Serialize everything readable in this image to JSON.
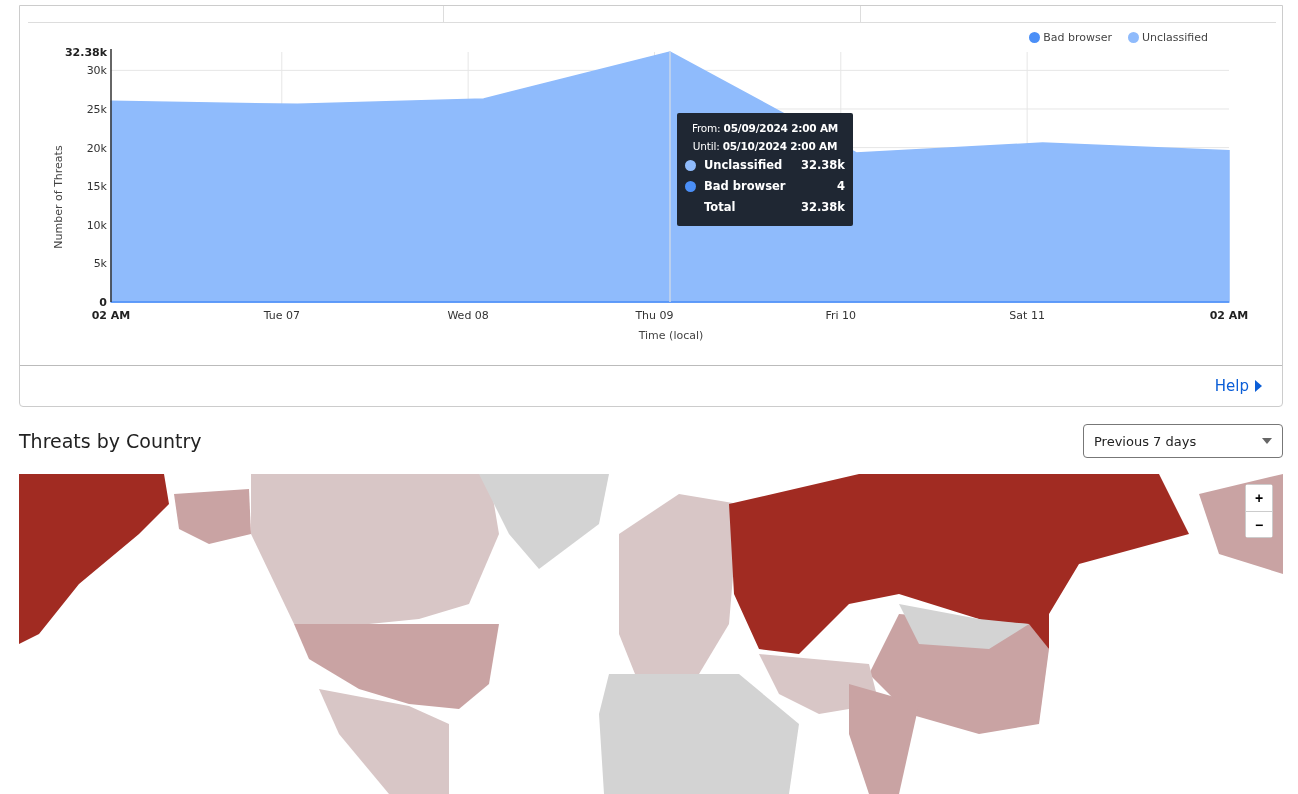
{
  "threats_chart": {
    "chart_data": {
      "type": "area",
      "grid": true,
      "legend": true,
      "xlabel": "Time (local)",
      "ylabel": "Number of Threats",
      "categories": [
        "02 AM",
        null,
        null,
        null,
        null,
        null,
        "02 AM"
      ],
      "series": [
        {
          "name": "Bad browser",
          "color": "#4b8ff7",
          "values": [
            0,
            0,
            0,
            4,
            0,
            0,
            0
          ]
        },
        {
          "name": "Unclassified",
          "color": "#8fbbfc",
          "values": [
            26000,
            25600,
            26300,
            32380,
            19300,
            20600,
            19600
          ]
        }
      ],
      "ylim": [
        0,
        32380
      ],
      "yticks": [
        {
          "value": 0,
          "label": "0"
        },
        {
          "value": 5000,
          "label": "5k"
        },
        {
          "value": 10000,
          "label": "10k"
        },
        {
          "value": 15000,
          "label": "15k"
        },
        {
          "value": 20000,
          "label": "20k"
        },
        {
          "value": 25000,
          "label": "25k"
        },
        {
          "value": 30000,
          "label": "30k"
        },
        {
          "value": 32380,
          "label": "32.38k"
        }
      ]
    },
    "tooltip": {
      "from_label": "From:",
      "from": "05/09/2024 2:00 AM",
      "until_label": "Until:",
      "until": "05/10/2024 2:00 AM",
      "rows": [
        {
          "name": "Unclassified",
          "value": "32.38k",
          "color": "#8fbbfc"
        },
        {
          "name": "Bad browser",
          "value": "4",
          "color": "#4b8ff7"
        }
      ],
      "total_label": "Total",
      "total": "32.38k"
    },
    "day_labels": [
      "Tue 07",
      "Wed 08",
      "Thu 09",
      "Fri 10",
      "Sat 11"
    ],
    "help_link": "Help"
  },
  "threats_by_country": {
    "title": "Threats by Country",
    "period_select": {
      "value": "Previous 7 days"
    },
    "zoom_in": "+",
    "zoom_out": "−"
  }
}
